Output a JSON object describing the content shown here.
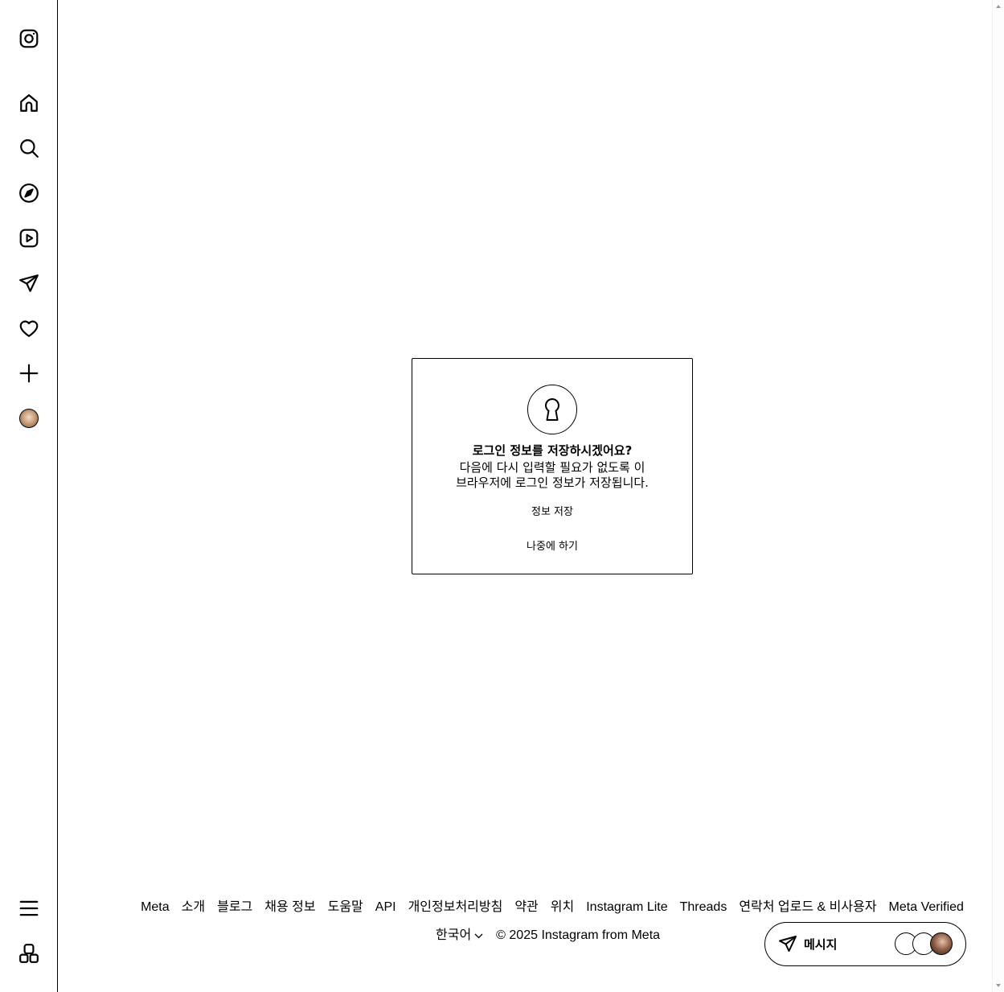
{
  "sidebar": {
    "items": [
      {
        "icon": "instagram-logo-icon",
        "label": "Instagram"
      },
      {
        "icon": "home-icon",
        "label": "홈"
      },
      {
        "icon": "search-icon",
        "label": "검색"
      },
      {
        "icon": "explore-icon",
        "label": "탐색 탭"
      },
      {
        "icon": "reels-icon",
        "label": "릴스"
      },
      {
        "icon": "messages-icon",
        "label": "메시지"
      },
      {
        "icon": "heart-icon",
        "label": "알림"
      },
      {
        "icon": "plus-icon",
        "label": "만들기"
      },
      {
        "icon": "profile-avatar",
        "label": "프로필"
      }
    ],
    "bottom_items": [
      {
        "icon": "menu-icon",
        "label": "더 보기"
      },
      {
        "icon": "apps-icon",
        "label": "Meta에서 더 보기"
      }
    ]
  },
  "modal": {
    "icon": "keyhole-icon",
    "title": "로그인 정보를 저장하시겠어요?",
    "description_line1": "다음에 다시 입력할 필요가 없도록 이",
    "description_line2": "브라우저에 로그인 정보가 저장됩니다.",
    "save_label": "정보 저장",
    "later_label": "나중에 하기"
  },
  "footer": {
    "links": [
      "Meta",
      "소개",
      "블로그",
      "채용 정보",
      "도움말",
      "API",
      "개인정보처리방침",
      "약관",
      "위치",
      "Instagram Lite",
      "Threads",
      "연락처 업로드 & 비사용자",
      "Meta Verified"
    ],
    "language": "한국어",
    "copyright": "© 2025 Instagram from Meta"
  },
  "messages_button": {
    "label": "메시지",
    "icon": "send-icon"
  },
  "colors": {
    "background": "#ffffff",
    "text": "#000000",
    "border": "#000000"
  }
}
